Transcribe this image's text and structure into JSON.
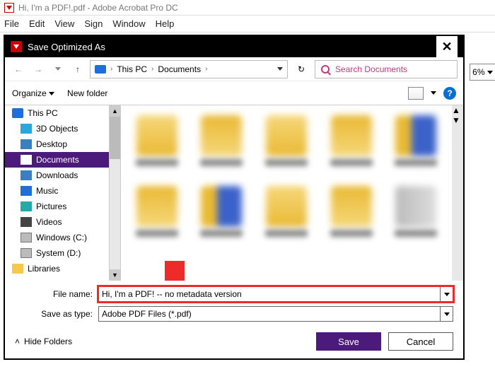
{
  "app": {
    "title": "Hi, I'm a PDF!.pdf - Adobe Acrobat Pro DC",
    "menu": [
      "File",
      "Edit",
      "View",
      "Sign",
      "Window",
      "Help"
    ],
    "zoom": "6%"
  },
  "dialog": {
    "title": "Save Optimized As",
    "close": "✕",
    "breadcrumb": {
      "root": "This PC",
      "folder": "Documents"
    },
    "search_placeholder": "Search Documents",
    "toolbar": {
      "organize": "Organize",
      "newfolder": "New folder"
    },
    "tree": [
      {
        "label": "This PC",
        "icon": "ico-pc",
        "root": true
      },
      {
        "label": "3D Objects",
        "icon": "ico-3d"
      },
      {
        "label": "Desktop",
        "icon": "ico-desktop"
      },
      {
        "label": "Documents",
        "icon": "ico-docs",
        "selected": true
      },
      {
        "label": "Downloads",
        "icon": "ico-dl"
      },
      {
        "label": "Music",
        "icon": "ico-music"
      },
      {
        "label": "Pictures",
        "icon": "ico-pics"
      },
      {
        "label": "Videos",
        "icon": "ico-vids"
      },
      {
        "label": "Windows (C:)",
        "icon": "ico-drive"
      },
      {
        "label": "System (D:)",
        "icon": "ico-drive"
      },
      {
        "label": "Libraries",
        "icon": "ico-lib"
      }
    ],
    "fields": {
      "filename_label": "File name:",
      "filename_value": "Hi, I'm a PDF! -- no metadata version",
      "type_label": "Save as type:",
      "type_value": "Adobe PDF Files (*.pdf)"
    },
    "footer": {
      "hide": "Hide Folders",
      "save": "Save",
      "cancel": "Cancel"
    }
  }
}
